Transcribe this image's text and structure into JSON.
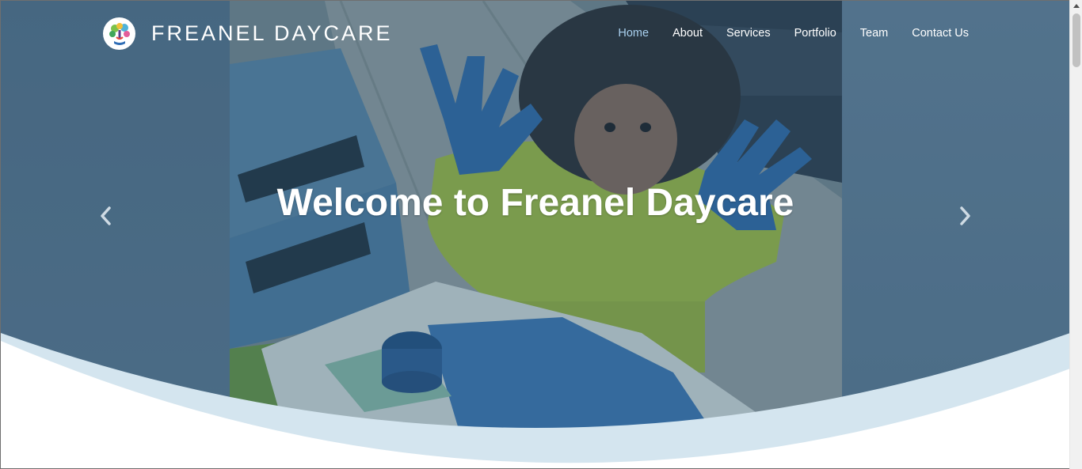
{
  "brand": {
    "name": "FREANEL DAYCARE",
    "logo_icon": "tree-hand-logo-icon"
  },
  "nav": {
    "items": [
      {
        "label": "Home",
        "active": true
      },
      {
        "label": "About",
        "active": false
      },
      {
        "label": "Services",
        "active": false
      },
      {
        "label": "Portfolio",
        "active": false
      },
      {
        "label": "Team",
        "active": false
      },
      {
        "label": "Contact Us",
        "active": false
      }
    ]
  },
  "hero": {
    "headline": "Welcome to Freanel Daycare",
    "prev_icon": "chevron-left-icon",
    "next_icon": "chevron-right-icon"
  },
  "colors": {
    "active_nav": "#a9d0ef",
    "overlay": "#2f5573",
    "wave_light": "#d4e5ef",
    "text": "#ffffff"
  }
}
